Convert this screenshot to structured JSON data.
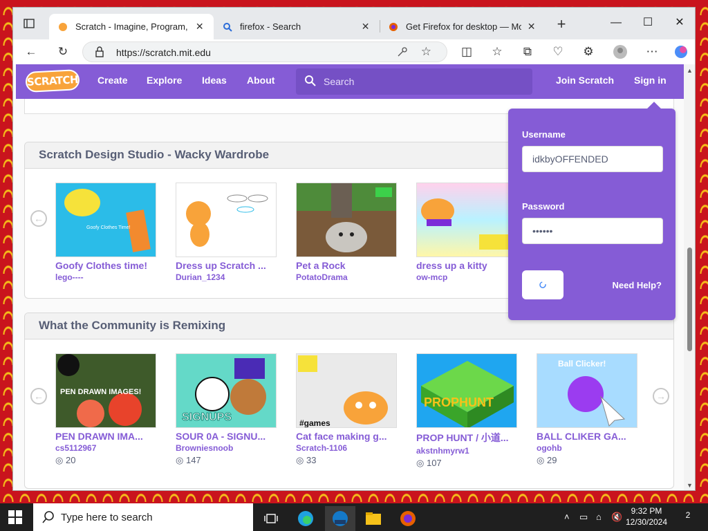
{
  "tabs": [
    {
      "title": "Scratch - Imagine, Program, Share",
      "icon": "scratch-cat-icon"
    },
    {
      "title": "firefox - Search",
      "icon": "search-icon"
    },
    {
      "title": "Get Firefox for desktop — Mozilla",
      "icon": "firefox-icon"
    }
  ],
  "address": {
    "url": "https://scratch.mit.edu"
  },
  "nav": {
    "logo": "SCRATCH",
    "create": "Create",
    "explore": "Explore",
    "ideas": "Ideas",
    "about": "About",
    "search_placeholder": "Search",
    "join": "Join Scratch",
    "signin": "Sign in"
  },
  "studio": {
    "title": "Scratch Design Studio - Wacky Wardrobe",
    "projects": [
      {
        "title": "Goofy Clothes time!",
        "author": "lego----"
      },
      {
        "title": "Dress up Scratch ...",
        "author": "Durian_1234"
      },
      {
        "title": "Pet a Rock",
        "author": "PotatoDrama"
      },
      {
        "title": "dress up a kitty",
        "author": "ow-mcp"
      }
    ]
  },
  "remix": {
    "title": "What the Community is Remixing",
    "projects": [
      {
        "title": "PEN DRAWN IMA...",
        "author": "cs5112967",
        "loves": "20"
      },
      {
        "title": "SOUR 0A - SIGNU...",
        "author": "Browniesnoob",
        "loves": "147"
      },
      {
        "title": "Cat face making g...",
        "author": "Scratch-1106",
        "loves": "33"
      },
      {
        "title": "PROP HUNT / 小道...",
        "author": "akstnhmyrw1",
        "loves": "107"
      },
      {
        "title": "BALL CLIKER GA...",
        "author": "ogohb",
        "loves": "29"
      }
    ]
  },
  "login": {
    "username_label": "Username",
    "username_value": "idkbyOFFENDED",
    "password_label": "Password",
    "password_value": "••••••",
    "help": "Need Help?"
  },
  "taskbar": {
    "search_placeholder": "Type here to search",
    "time": "9:32 PM",
    "date": "12/30/2024",
    "notifications": "2"
  },
  "colors": {
    "scratch_purple": "#855cd6",
    "scratch_orange": "#f8a33a"
  }
}
